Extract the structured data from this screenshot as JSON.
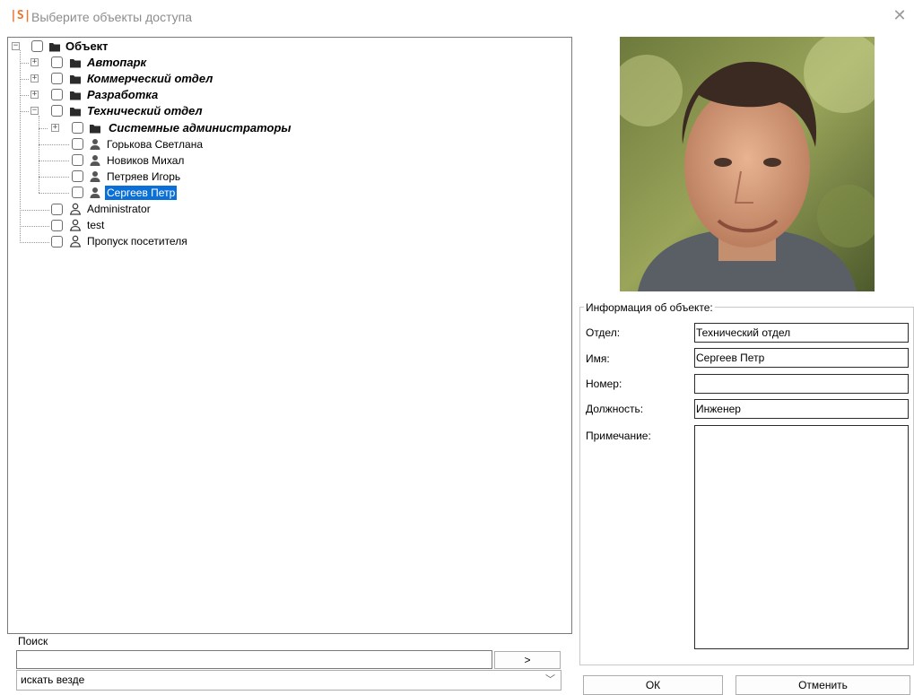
{
  "window": {
    "logo": "|S|",
    "title": "Выберите объекты доступа",
    "close_glyph": "✕"
  },
  "tree": {
    "root": {
      "label": "Объект"
    },
    "groups": [
      {
        "label": "Автопарк"
      },
      {
        "label": "Коммерческий отдел"
      },
      {
        "label": "Разработка"
      },
      {
        "label": "Технический отдел"
      }
    ],
    "subgroup": {
      "label": "Системные администраторы"
    },
    "people": [
      {
        "label": "Горькова Светлана",
        "icon": "person-icon"
      },
      {
        "label": "Новиков Михал",
        "icon": "person-icon"
      },
      {
        "label": "Петряев Игорь",
        "icon": "person-icon"
      },
      {
        "label": "Сергеев Петр",
        "icon": "person-icon",
        "selected": true
      }
    ],
    "users": [
      {
        "label": "Administrator",
        "icon": "user-outline-icon"
      },
      {
        "label": "test",
        "icon": "user-outline-icon"
      },
      {
        "label": "Пропуск посетителя",
        "icon": "user-outline-icon"
      }
    ],
    "expander_plus": "+",
    "expander_minus": "−"
  },
  "search": {
    "label": "Поиск",
    "value": "",
    "go_label": ">",
    "scope_value": "искать везде",
    "scope_chevron": "﹀"
  },
  "info": {
    "legend": "Информация об объекте:",
    "department_label": "Отдел:",
    "department_value": "Технический отдел",
    "name_label": "Имя:",
    "name_value": "Сергеев Петр",
    "number_label": "Номер:",
    "number_value": "",
    "position_label": "Должность:",
    "position_value": "Инженер",
    "note_label": "Примечание:",
    "note_value": ""
  },
  "buttons": {
    "ok": "ОК",
    "cancel": "Отменить"
  },
  "colors": {
    "selection": "#0a6fd6",
    "logo": "#e8772e",
    "folder": "#2b2b2b"
  }
}
